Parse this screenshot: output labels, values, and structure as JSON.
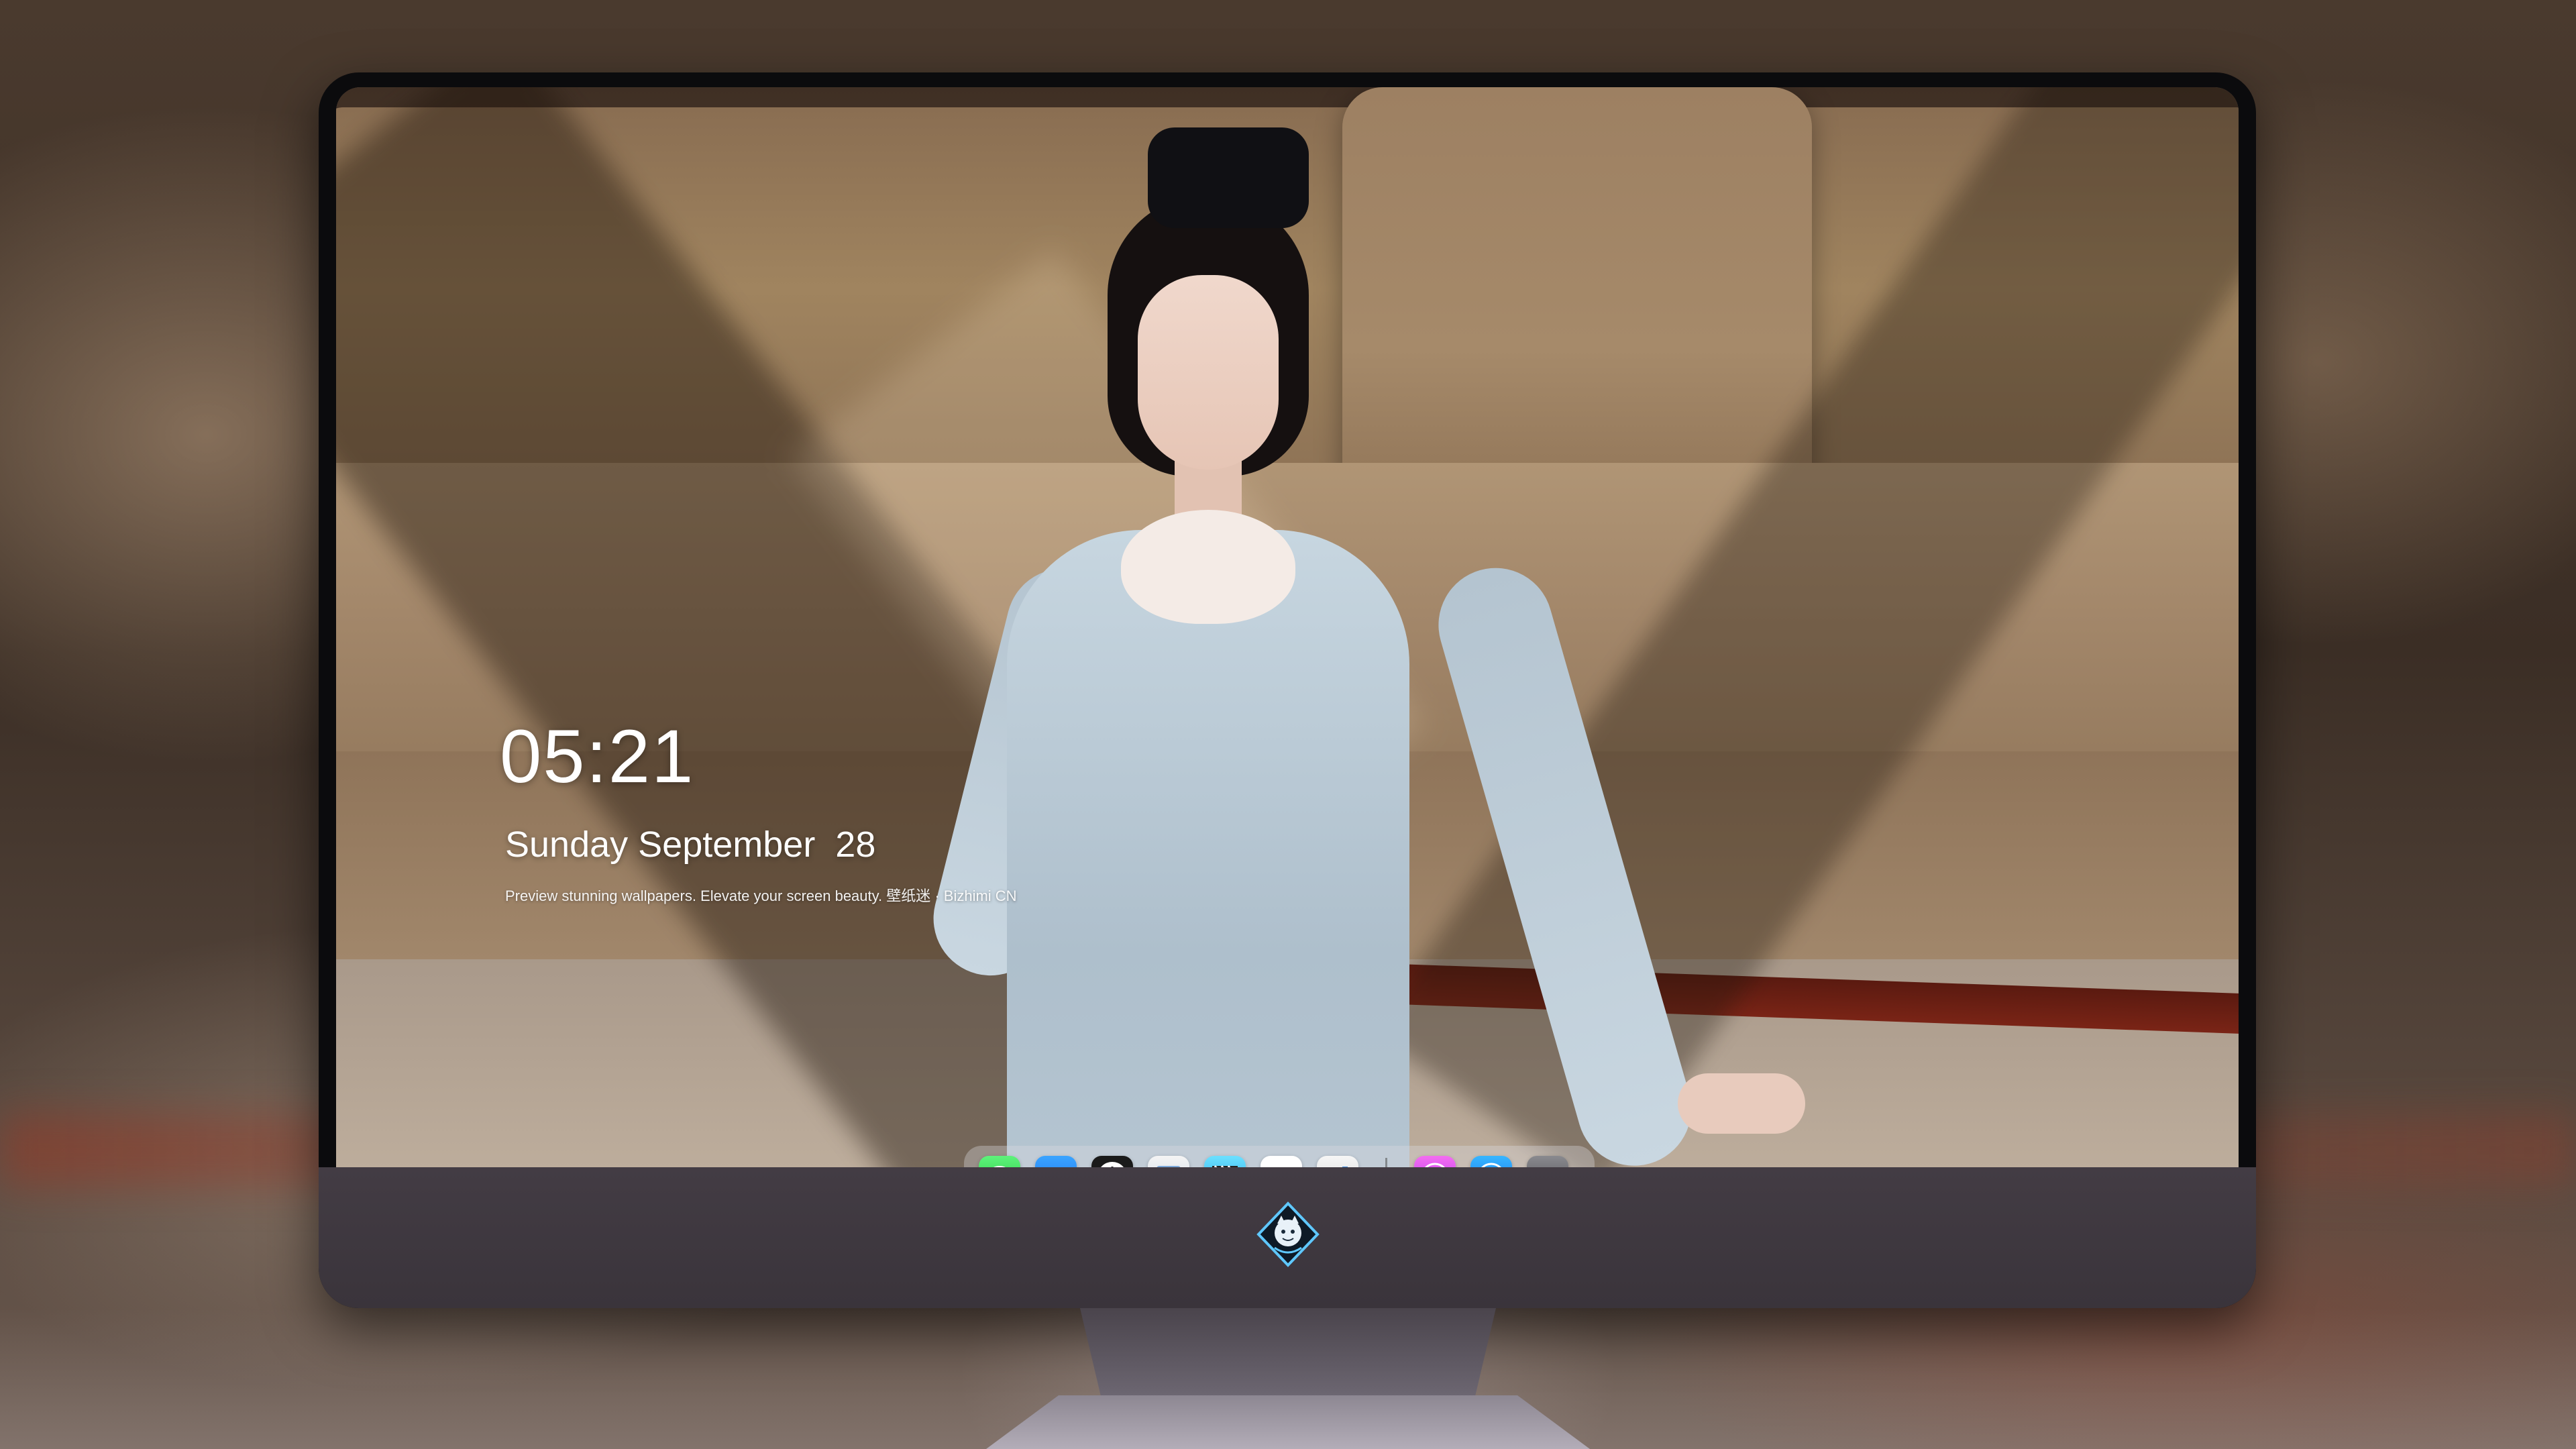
{
  "lock_screen": {
    "time": "05:21",
    "date": "Sunday September  28",
    "tagline": "Preview stunning wallpapers. Elevate your screen beauty. 壁纸迷 · Bizhimi CN"
  },
  "dock": {
    "apps": [
      {
        "name": "Messages",
        "icon": "messages-icon"
      },
      {
        "name": "Weather",
        "icon": "weather-icon"
      },
      {
        "name": "Clock",
        "icon": "clock-icon"
      },
      {
        "name": "Preview",
        "icon": "preview-icon"
      },
      {
        "name": "Clips",
        "icon": "clips-icon"
      },
      {
        "name": "Notes",
        "icon": "notes-icon"
      },
      {
        "name": "Numbers",
        "icon": "numbers-icon"
      },
      {
        "name": "iTunes",
        "icon": "itunes-icon"
      },
      {
        "name": "App Store",
        "icon": "app-store-icon"
      },
      {
        "name": "Camera",
        "icon": "camera-icon"
      }
    ]
  },
  "monitor": {
    "brand_icon": "dragon-mascot-logo-icon"
  },
  "colors": {
    "dock_background": "#dcdce1",
    "text": "#ffffff",
    "bezel": "#0b0b0d",
    "chin": "#433c44"
  }
}
